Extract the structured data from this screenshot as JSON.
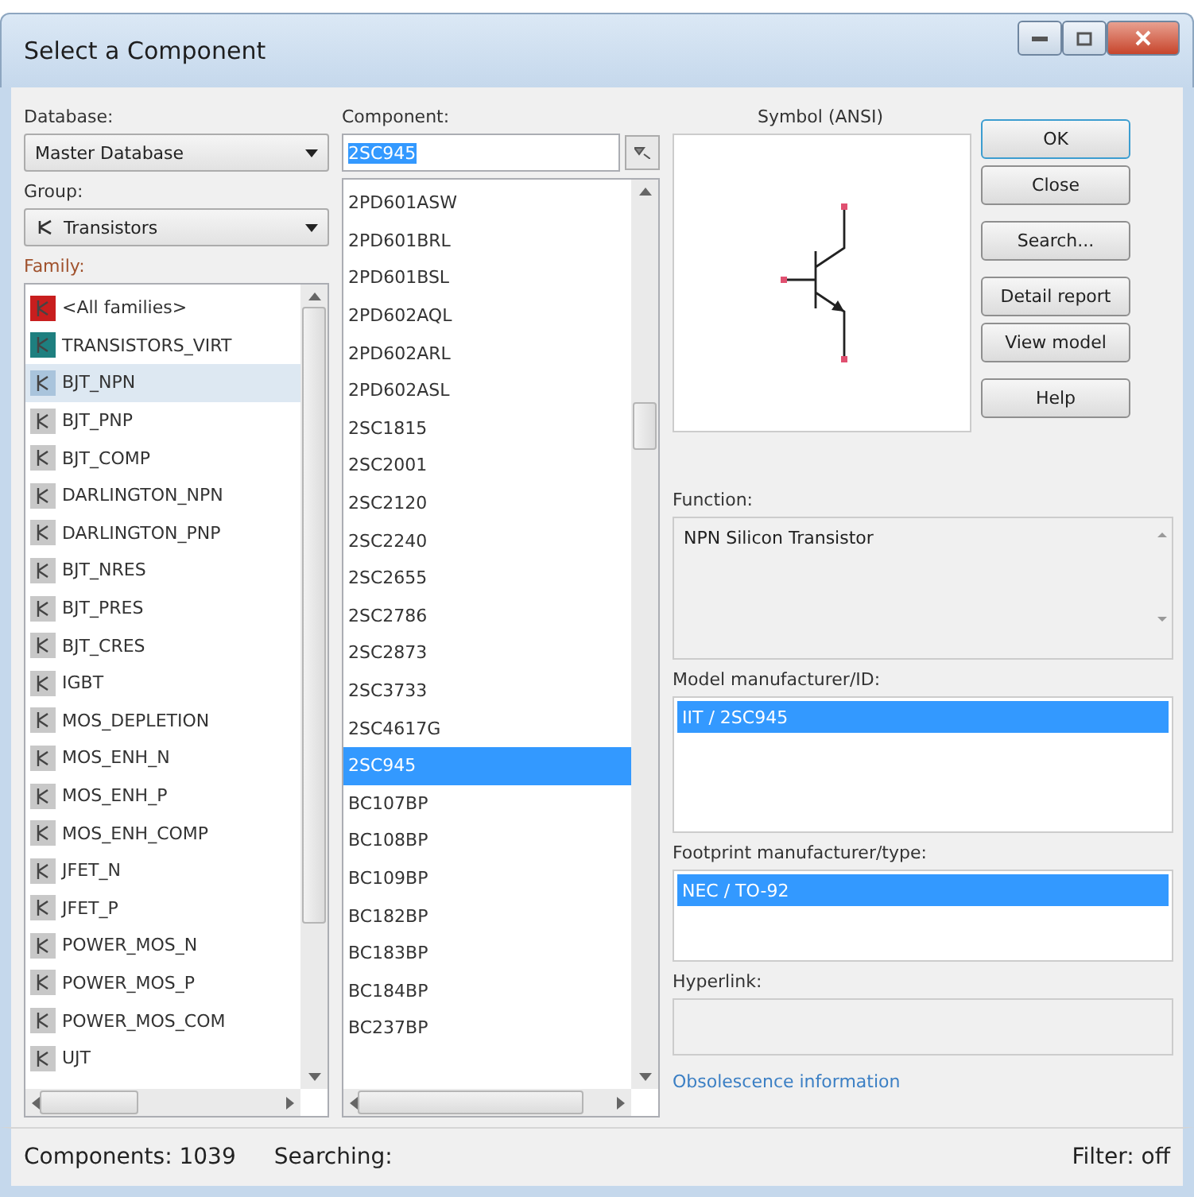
{
  "window": {
    "title": "Select a Component"
  },
  "database": {
    "label": "Database:",
    "value": "Master Database"
  },
  "group": {
    "label": "Group:",
    "value": "Transistors"
  },
  "family": {
    "label": "Family:",
    "items": [
      {
        "label": "<All families>",
        "selected": false,
        "color": "#c81e1e"
      },
      {
        "label": "TRANSISTORS_VIRT",
        "selected": false,
        "color": "#1e7f7f"
      },
      {
        "label": "BJT_NPN",
        "selected": true,
        "color": "#a9c4dc"
      },
      {
        "label": "BJT_PNP",
        "selected": false,
        "color": "#c8c8c8"
      },
      {
        "label": "BJT_COMP",
        "selected": false,
        "color": "#c8c8c8"
      },
      {
        "label": "DARLINGTON_NPN",
        "selected": false,
        "color": "#c8c8c8"
      },
      {
        "label": "DARLINGTON_PNP",
        "selected": false,
        "color": "#c8c8c8"
      },
      {
        "label": "BJT_NRES",
        "selected": false,
        "color": "#c8c8c8"
      },
      {
        "label": "BJT_PRES",
        "selected": false,
        "color": "#c8c8c8"
      },
      {
        "label": "BJT_CRES",
        "selected": false,
        "color": "#c8c8c8"
      },
      {
        "label": "IGBT",
        "selected": false,
        "color": "#c8c8c8"
      },
      {
        "label": "MOS_DEPLETION",
        "selected": false,
        "color": "#c8c8c8"
      },
      {
        "label": "MOS_ENH_N",
        "selected": false,
        "color": "#c8c8c8"
      },
      {
        "label": "MOS_ENH_P",
        "selected": false,
        "color": "#c8c8c8"
      },
      {
        "label": "MOS_ENH_COMP",
        "selected": false,
        "color": "#c8c8c8"
      },
      {
        "label": "JFET_N",
        "selected": false,
        "color": "#c8c8c8"
      },
      {
        "label": "JFET_P",
        "selected": false,
        "color": "#c8c8c8"
      },
      {
        "label": "POWER_MOS_N",
        "selected": false,
        "color": "#c8c8c8"
      },
      {
        "label": "POWER_MOS_P",
        "selected": false,
        "color": "#c8c8c8"
      },
      {
        "label": "POWER_MOS_COM",
        "selected": false,
        "color": "#c8c8c8"
      },
      {
        "label": "UJT",
        "selected": false,
        "color": "#c8c8c8"
      }
    ]
  },
  "component": {
    "label": "Component:",
    "value": "2SC945",
    "items": [
      {
        "label": "2PD601ASW",
        "selected": false
      },
      {
        "label": "2PD601BRL",
        "selected": false
      },
      {
        "label": "2PD601BSL",
        "selected": false
      },
      {
        "label": "2PD602AQL",
        "selected": false
      },
      {
        "label": "2PD602ARL",
        "selected": false
      },
      {
        "label": "2PD602ASL",
        "selected": false
      },
      {
        "label": "2SC1815",
        "selected": false
      },
      {
        "label": "2SC2001",
        "selected": false
      },
      {
        "label": "2SC2120",
        "selected": false
      },
      {
        "label": "2SC2240",
        "selected": false
      },
      {
        "label": "2SC2655",
        "selected": false
      },
      {
        "label": "2SC2786",
        "selected": false
      },
      {
        "label": "2SC2873",
        "selected": false
      },
      {
        "label": "2SC3733",
        "selected": false
      },
      {
        "label": "2SC4617G",
        "selected": false
      },
      {
        "label": "2SC945",
        "selected": true
      },
      {
        "label": "BC107BP",
        "selected": false
      },
      {
        "label": "BC108BP",
        "selected": false
      },
      {
        "label": "BC109BP",
        "selected": false
      },
      {
        "label": "BC182BP",
        "selected": false
      },
      {
        "label": "BC183BP",
        "selected": false
      },
      {
        "label": "BC184BP",
        "selected": false
      },
      {
        "label": "BC237BP",
        "selected": false
      }
    ]
  },
  "symbol": {
    "label": "Symbol (ANSI)"
  },
  "buttons": [
    {
      "label": "OK",
      "kind": "default"
    },
    {
      "label": "Close",
      "kind": "normal"
    },
    {
      "label": "Search...",
      "kind": "spaced"
    },
    {
      "label": "Detail report",
      "kind": "spaced"
    },
    {
      "label": "View model",
      "kind": "normal"
    },
    {
      "label": "Help",
      "kind": "spaced"
    }
  ],
  "function": {
    "label": "Function:",
    "value": "NPN Silicon Transistor"
  },
  "model": {
    "label": "Model manufacturer/ID:",
    "items": [
      {
        "label": "IIT / 2SC945",
        "selected": true
      }
    ]
  },
  "footprint": {
    "label": "Footprint manufacturer/type:",
    "items": [
      {
        "label": "NEC / TO-92",
        "selected": true
      }
    ]
  },
  "hyperlink": {
    "label": "Hyperlink:"
  },
  "obsolescence_link": "Obsolescence information",
  "status_bar": {
    "components": "Components: 1039",
    "searching": "Searching:",
    "filter": "Filter: off"
  }
}
